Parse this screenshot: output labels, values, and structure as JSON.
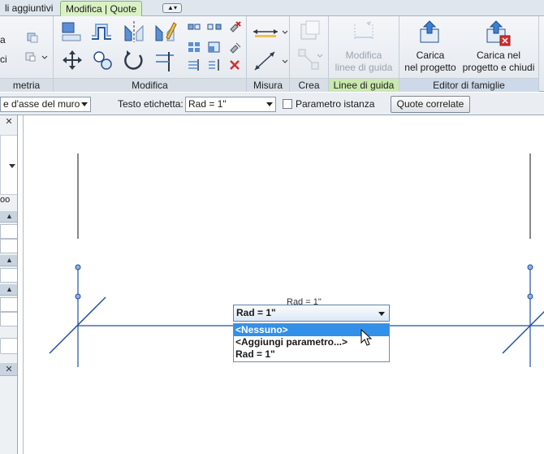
{
  "tabs": {
    "addins": "li aggiuntivi",
    "active": "Modifica | Quote"
  },
  "ribbon": {
    "panels": {
      "geometria": "metria",
      "modifica": "Modifica",
      "misura": "Misura",
      "crea": "Crea",
      "linee_guida": "Linee di guida",
      "editor_famiglie": "Editor di famiglie"
    },
    "left_stub": {
      "line1": "a",
      "line2": "ci"
    },
    "modifica_linee_guida": {
      "line1": "Modifica",
      "line2": "linee di guida"
    },
    "carica_progetto": {
      "line1": "Carica",
      "line2": "nel progetto"
    },
    "carica_chiudi": {
      "line1": "Carica nel",
      "line2": "progetto e chiudi"
    }
  },
  "options_bar": {
    "placement_value": "e d'asse del muro",
    "label_text": "Testo etichetta:",
    "label_value": "Rad = 1\"",
    "instance_param": "Parametro istanza",
    "quote_correlate": "Quote correlate"
  },
  "left_panel": {
    "text_oo": "oo"
  },
  "drawing": {
    "ghost_text": "Rad = 1\"",
    "dropdown": {
      "selected": "Rad = 1\"",
      "options": [
        "<Nessuno>",
        "<Aggiungi parametro...>",
        "Rad = 1\""
      ],
      "highlighted_index": 0
    }
  },
  "colors": {
    "line_blue": "#1f4fa0",
    "highlight": "#3390e8",
    "green_tab": "#d9f1c4"
  }
}
